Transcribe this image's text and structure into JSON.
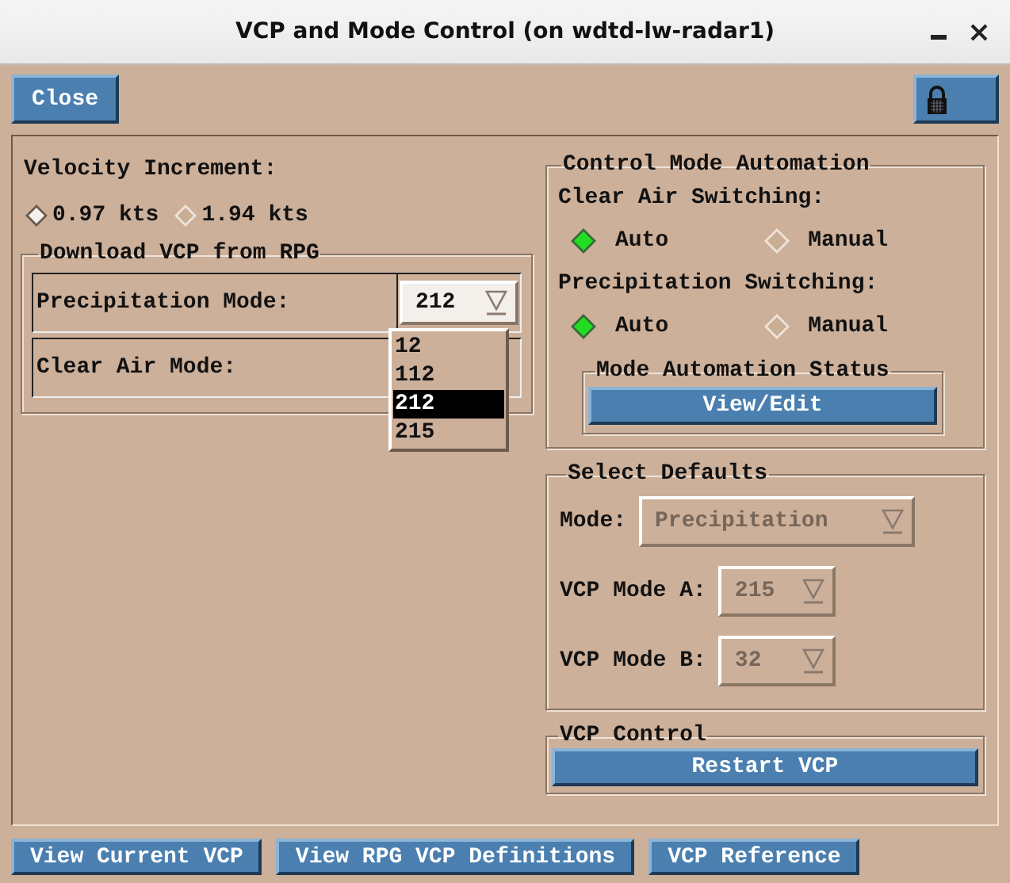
{
  "window": {
    "title": "VCP and Mode Control (on wdtd-lw-radar1)"
  },
  "toolbar": {
    "close_button": "Close"
  },
  "velocity_increment": {
    "label": "Velocity Increment:",
    "options": [
      {
        "label": "0.97 kts",
        "selected": true
      },
      {
        "label": "1.94 kts",
        "selected": false
      }
    ]
  },
  "download": {
    "title": "Download VCP from RPG",
    "precipitation_mode": {
      "label": "Precipitation Mode:",
      "value": "212",
      "expanded": true,
      "options": [
        {
          "label": "12",
          "selected": false
        },
        {
          "label": "112",
          "selected": false
        },
        {
          "label": "212",
          "selected": true
        },
        {
          "label": "215",
          "selected": false
        }
      ]
    },
    "clear_air_mode": {
      "label": "Clear Air Mode:"
    }
  },
  "automation": {
    "title": "Control Mode Automation",
    "groups": [
      {
        "label": "Clear Air Switching:",
        "options": [
          {
            "label": "Auto",
            "selected": true
          },
          {
            "label": "Manual",
            "selected": false
          }
        ]
      },
      {
        "label": "Precipitation Switching:",
        "options": [
          {
            "label": "Auto",
            "selected": true
          },
          {
            "label": "Manual",
            "selected": false
          }
        ]
      }
    ],
    "status": {
      "title": "Mode Automation Status",
      "button": "View/Edit"
    }
  },
  "defaults": {
    "title": "Select Defaults",
    "fields": [
      {
        "label": "Mode:",
        "value": "Precipitation",
        "disabled": true,
        "kind": "wide"
      },
      {
        "label": "VCP Mode A:",
        "value": "215",
        "disabled": true,
        "kind": "narrow"
      },
      {
        "label": "VCP Mode B:",
        "value": "32",
        "disabled": true,
        "kind": "narrow"
      }
    ]
  },
  "vcp_control": {
    "title": "VCP Control",
    "button": "Restart VCP"
  },
  "bottom_buttons": [
    "View Current VCP",
    "View RPG VCP Definitions",
    "VCP Reference"
  ]
}
